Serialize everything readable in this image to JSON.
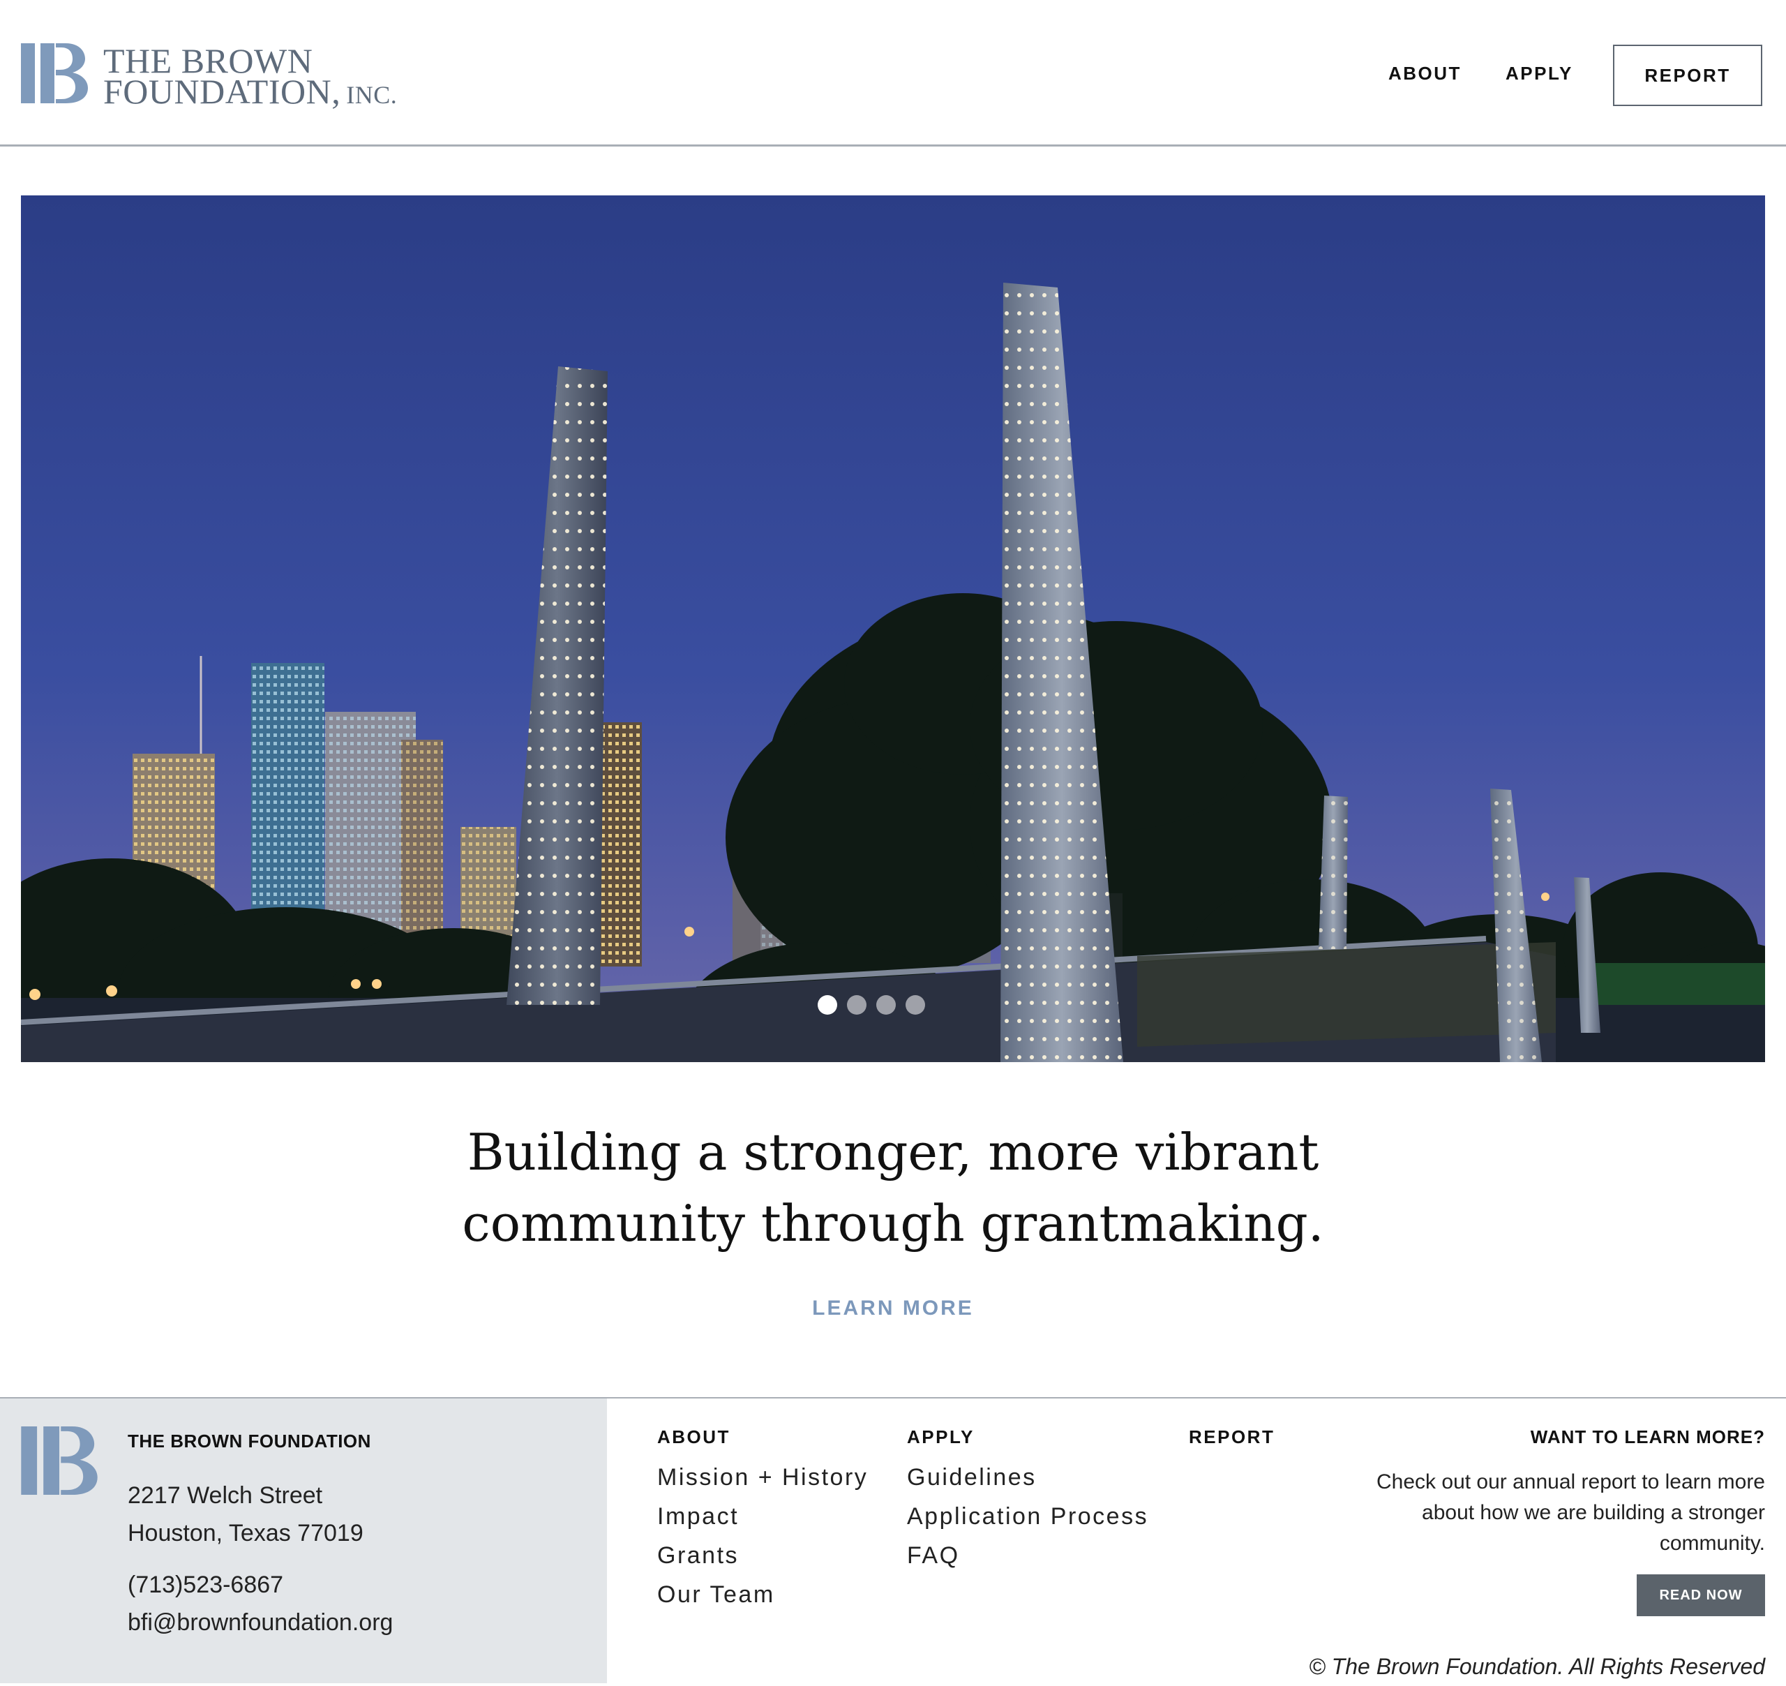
{
  "brand": {
    "line1": "THE BROWN",
    "line2": "FOUNDATION,",
    "inc": "INC.",
    "color": "#7f9abb"
  },
  "nav": {
    "about": "ABOUT",
    "apply": "APPLY",
    "report": "REPORT"
  },
  "hero": {
    "image": "houston-skyline-at-dusk-with-illuminated-tower-sculptures",
    "slides": 4,
    "active_slide": 1
  },
  "tagline": {
    "line1": "Building a stronger, more vibrant",
    "line2": "community through grantmaking.",
    "cta": "LEARN MORE",
    "cta_color": "#7c98bb"
  },
  "footer": {
    "org_name": "THE BROWN FOUNDATION",
    "address_line1": "2217 Welch Street",
    "address_line2": "Houston, Texas 77019",
    "phone": "(713)523-6867",
    "email": "bfi@brownfoundation.org",
    "about": {
      "heading": "ABOUT",
      "links": [
        "Mission + History",
        "Impact",
        "Grants",
        "Our Team"
      ]
    },
    "apply": {
      "heading": "APPLY",
      "links": [
        "Guidelines",
        "Application Process",
        "FAQ"
      ]
    },
    "report": {
      "heading": "REPORT"
    },
    "learn": {
      "heading": "WANT TO LEARN MORE?",
      "body": "Check out our annual report to learn more about how we are building a stronger community.",
      "button": "READ NOW"
    },
    "copyright": "© The Brown Foundation. All Rights Reserved",
    "panel_color": "#e3e6e9"
  }
}
